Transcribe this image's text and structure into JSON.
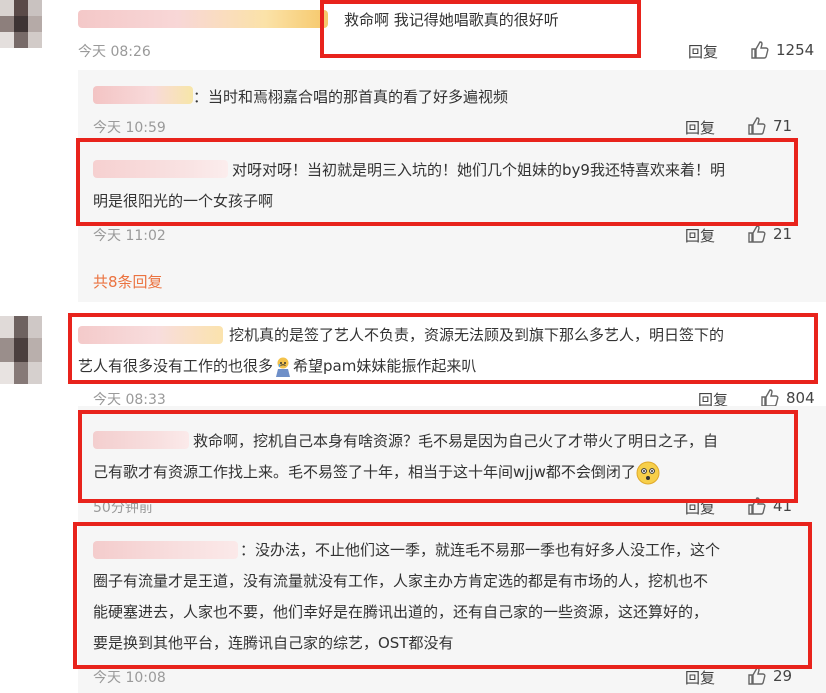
{
  "comments": [
    {
      "text": "救命啊 我记得她唱歌真的很好听",
      "time": "今天 08:26",
      "reply": "回复",
      "likes": "1254"
    },
    {
      "text": "挖机真的是签了艺人不负责，资源无法顾及到旗下那么多艺人，明日签下的",
      "text_line2a": "艺人有很多没有工作的也很多",
      "text_line2b": "希望pam妹妹能振作起来叭",
      "time": "今天 08:33",
      "reply": "回复",
      "likes": "804"
    }
  ],
  "replies": [
    {
      "text": "：当时和焉栩嘉合唱的那首真的看了好多遍视频",
      "time": "今天 10:59",
      "reply": "回复",
      "likes": "71"
    },
    {
      "line1": "对呀对呀！当初就是明三入坑的！她们几个姐妹的by9我还特喜欢来着！明",
      "line2": "明是很阳光的一个女孩子啊",
      "time": "今天 11:02",
      "reply": "回复",
      "likes": "21"
    },
    {
      "line1": "救命啊，挖机自己本身有啥资源？毛不易是因为自己火了才带火了明日之子，自",
      "line2": "己有歌才有资源工作找上来。毛不易签了十年，相当于这十年间wjjw都不会倒闭了",
      "time": "50分钟前",
      "reply": "回复",
      "likes": "41"
    },
    {
      "line1": "：没办法，不止他们这一季，就连毛不易那一季也有好多人没工作，这个",
      "line2": "圈子有流量才是王道，没有流量就没有工作，人家主办方肯定选的都是有市场的人，挖机也不",
      "line3": "能硬塞进去，人家也不要，他们幸好是在腾讯出道的，还有自己家的一些资源，这还算好的，",
      "line4": "要是换到其他平台，连腾讯自己家的综艺，OST都没有",
      "time": "今天 10:08",
      "reply": "回复",
      "likes": "29"
    }
  ],
  "more_replies": "共8条回复",
  "colors": {
    "highlight_border": "#e8231c",
    "more_link": "#eb7340",
    "sub_background": "#f6f6f6"
  },
  "icons": [
    "thumbs-up-icon",
    "avatar",
    "dizzy-face-emoji",
    "crying-person-emoji"
  ]
}
